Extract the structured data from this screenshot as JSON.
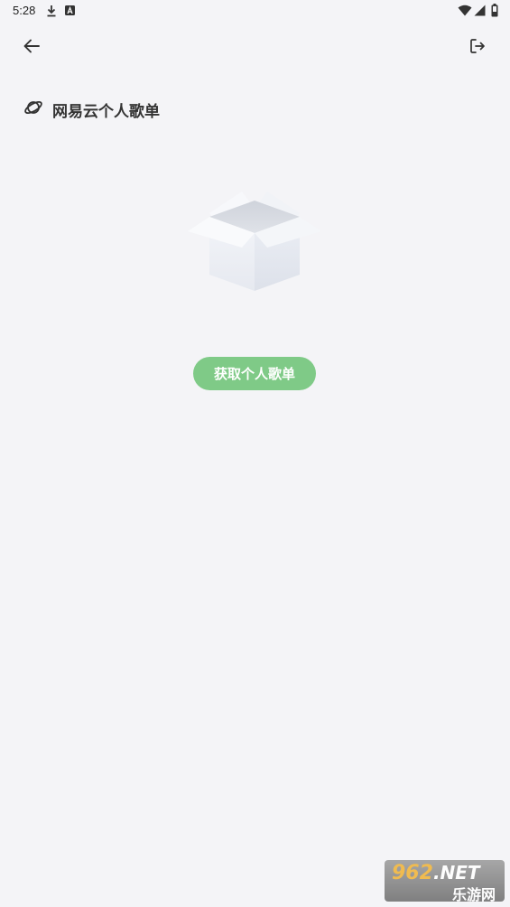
{
  "status_bar": {
    "time": "5:28",
    "icons": [
      "download-icon",
      "a-notification-icon",
      "wifi-icon",
      "signal-icon",
      "battery-icon"
    ]
  },
  "toolbar": {
    "back_icon": "arrow-left-icon",
    "logout_icon": "logout-icon"
  },
  "section": {
    "icon": "planet-icon",
    "title": "网易云个人歌单"
  },
  "empty_state": {
    "illustration": "empty-box-icon"
  },
  "actions": {
    "fetch_label": "获取个人歌单"
  },
  "watermark": {
    "top_number": "962",
    "top_suffix": ".NET",
    "bottom_text": "乐游网"
  },
  "colors": {
    "background": "#f4f4f7",
    "accent": "#7fca87",
    "text": "#333333"
  }
}
